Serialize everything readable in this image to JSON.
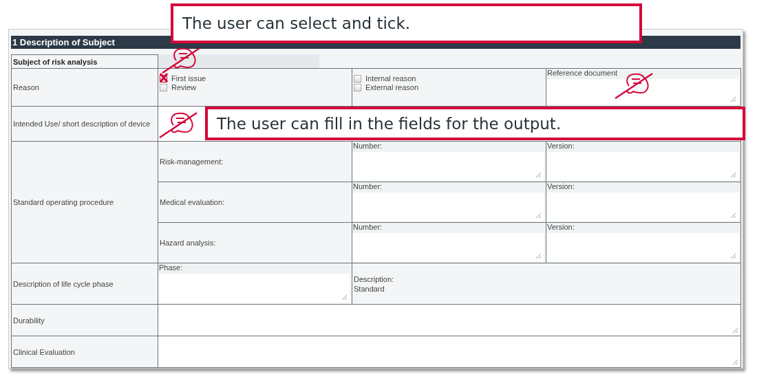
{
  "section": {
    "title": "1 Description of Subject"
  },
  "rows": [
    {
      "kind": "subject",
      "label": "Subject of risk analysis"
    },
    {
      "kind": "reason",
      "label": "Reason",
      "checkboxes_left": [
        {
          "label": "First issue",
          "checked": true
        },
        {
          "label": "Review",
          "checked": false
        }
      ],
      "checkboxes_right": [
        {
          "label": "Internal reason",
          "checked": false
        },
        {
          "label": "External reason",
          "checked": false
        }
      ],
      "field_label": "Reference document"
    },
    {
      "kind": "textarea",
      "label": "Intended Use/ short description of device"
    },
    {
      "kind": "sop",
      "label": "Standard operating procedure",
      "items": [
        {
          "label": "Risk-management:",
          "number_label": "Number:",
          "version_label": "Version:"
        },
        {
          "label": "Medical evaluation:",
          "number_label": "Number:",
          "version_label": "Version:"
        },
        {
          "label": "Hazard analysis:",
          "number_label": "Number:",
          "version_label": "Version:"
        }
      ]
    },
    {
      "kind": "lifecycle",
      "label": "Description of life cycle phase",
      "field_label": "Phase:",
      "description_label": "Description:",
      "description_value": "Standard"
    },
    {
      "kind": "textarea",
      "label": "Durability"
    },
    {
      "kind": "textarea",
      "label": "Clinical Evaluation"
    }
  ],
  "callouts": [
    {
      "text": "The user can select and tick."
    },
    {
      "text": "The user can fill in the fields for the output."
    }
  ]
}
